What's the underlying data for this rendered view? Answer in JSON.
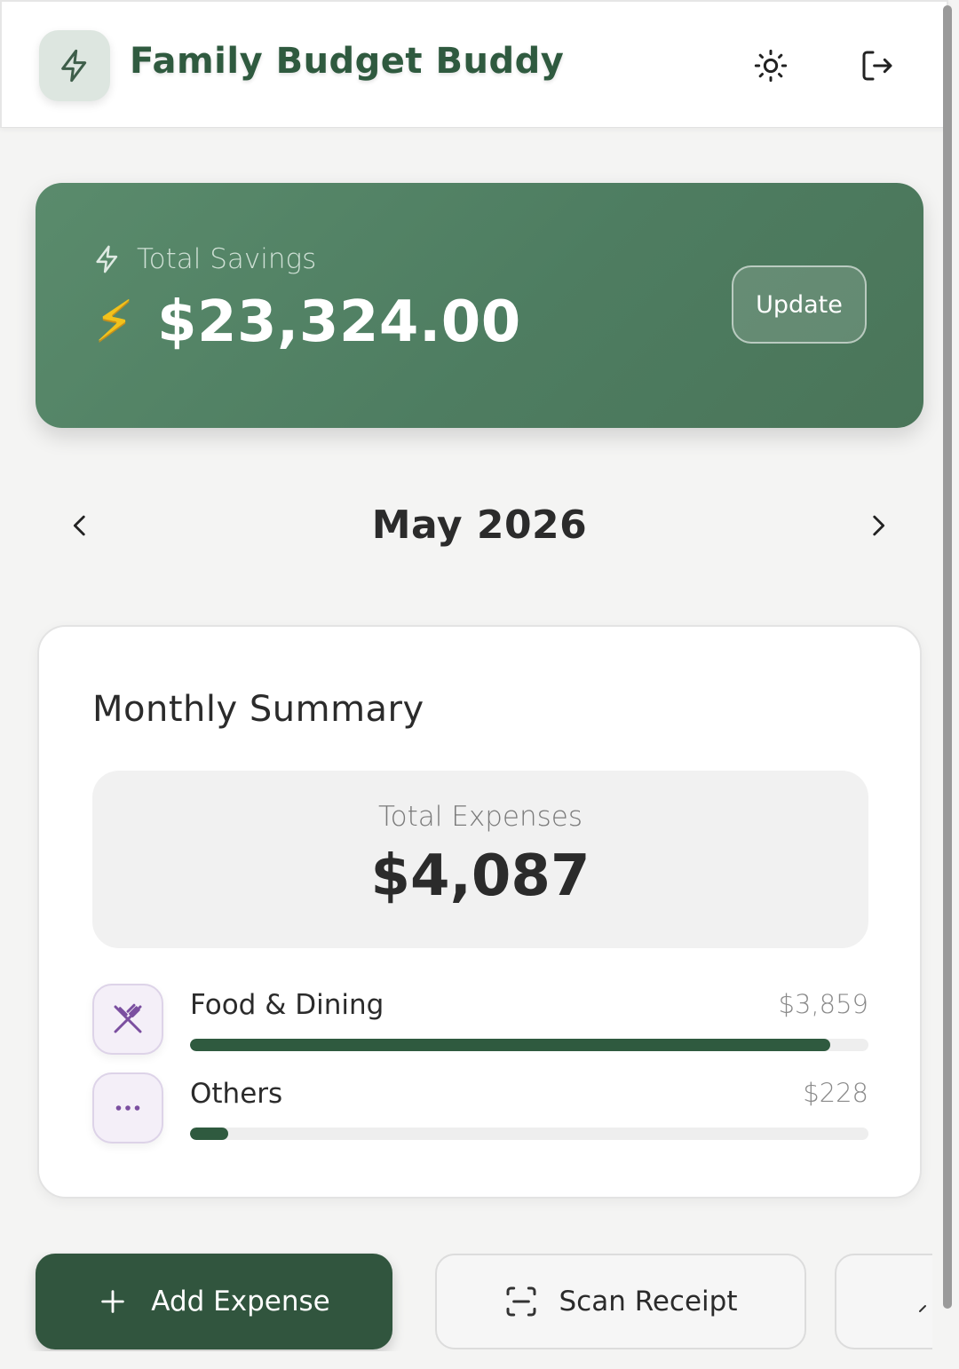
{
  "header": {
    "title": "Family Budget Buddy",
    "logo_icon": "bolt-icon",
    "theme_icon": "sun-icon",
    "logout_icon": "logout-icon"
  },
  "savings": {
    "label": "Total Savings",
    "amount": "$23,324.00",
    "emoji": "⚡",
    "update_label": "Update"
  },
  "month_nav": {
    "label": "May 2026"
  },
  "summary": {
    "title": "Monthly Summary",
    "total_label": "Total Expenses",
    "total_amount": "$4,087",
    "categories": [
      {
        "name": "Food & Dining",
        "amount": "$3,859",
        "fraction": 0.944,
        "icon": "utensils-crossed-icon"
      },
      {
        "name": "Others",
        "amount": "$228",
        "fraction": 0.056,
        "icon": "more-dots-icon"
      }
    ]
  },
  "actions": {
    "add_label": "Add Expense",
    "scan_label": "Scan Receipt"
  },
  "colors": {
    "accent": "#31553e",
    "title_green": "#2f5a3f",
    "savings_card": "#55856a",
    "category_icon": "#7b4fa0"
  }
}
